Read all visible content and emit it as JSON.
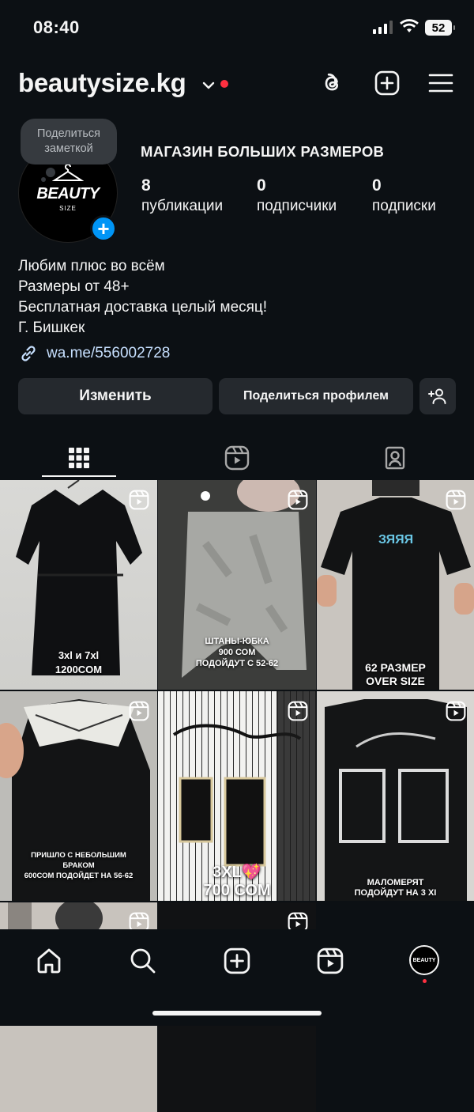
{
  "status": {
    "time": "08:40",
    "battery": "52"
  },
  "header": {
    "username": "beautysize.kg"
  },
  "note": {
    "text": "Поделиться заметкой"
  },
  "profile": {
    "avatar_brand": "BEAUTY",
    "avatar_sub": "SIZE",
    "full_name": "МАГАЗИН БОЛЬШИХ РАЗМЕРОВ",
    "stats": [
      {
        "value": "8",
        "label": "публикации"
      },
      {
        "value": "0",
        "label": "подписчики"
      },
      {
        "value": "0",
        "label": "подписки"
      }
    ],
    "bio": [
      "Любим плюс во всём",
      "Размеры от 48+",
      "Бесплатная доставка целый месяц!",
      "Г. Бишкек"
    ],
    "link": "wa.me/556002728"
  },
  "buttons": {
    "edit": "Изменить",
    "share": "Поделиться профилем"
  },
  "posts": [
    {
      "caption": [
        "3xl и 7xl",
        "1200COM"
      ]
    },
    {
      "caption": [
        "ШТАНЫ-ЮБКА",
        "900 СОМ",
        "ПОДОЙДУТ С 52-62"
      ]
    },
    {
      "caption": [
        "62 РАЗМЕР",
        "OVER SIZE"
      ]
    },
    {
      "caption": [
        "ПРИШЛО С НЕБОЛЬШИМ",
        "БРАКОМ",
        "600СОМ ПОДОЙДЕТ НА 56-62"
      ]
    },
    {
      "caption": [
        "3XL💖",
        "700 СОМ"
      ]
    },
    {
      "caption": [
        "МАЛОМЕРЯТ",
        "ПОДОЙДУТ НА 3 XI"
      ]
    },
    {
      "caption": []
    },
    {
      "caption": []
    }
  ],
  "colors": {
    "background": "#0c1014",
    "accent": "#0095f6",
    "button": "#25292e",
    "notification": "#ff3040"
  },
  "icons": [
    "threads-icon",
    "new-post-icon",
    "menu-icon",
    "grid-icon",
    "reels-tab-icon",
    "tagged-icon",
    "home-icon",
    "search-icon",
    "create-icon",
    "reels-icon",
    "link-icon",
    "add-person-icon"
  ]
}
